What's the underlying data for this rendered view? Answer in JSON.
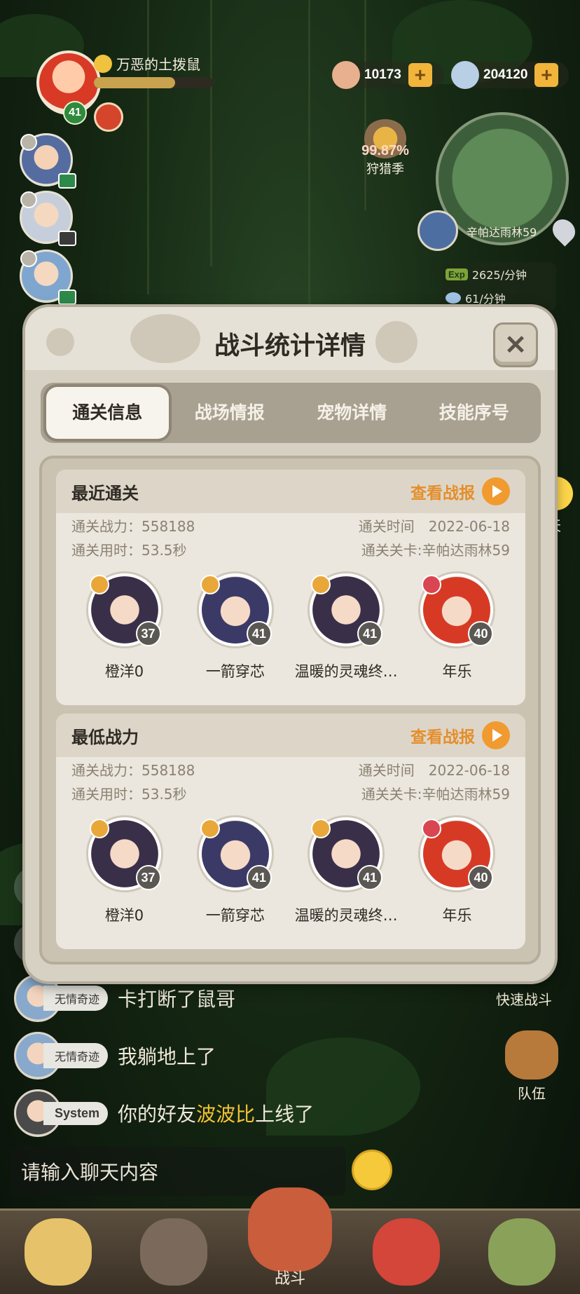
{
  "player": {
    "name": "万恶的土拨鼠",
    "level": "41",
    "xp_fraction": 0.68
  },
  "currency": [
    {
      "icon": "gem-pouch-icon",
      "value": "10173"
    },
    {
      "icon": "stone-icon",
      "value": "204120"
    }
  ],
  "hunt": {
    "percent": "99.87%",
    "label": "狩猎季"
  },
  "map": {
    "location": "辛帕达雨林59"
  },
  "rates": {
    "exp_tag": "Exp",
    "exp_rate": "2625/分钟",
    "stone_rate": "61/分钟"
  },
  "side": {
    "chat_label": "聊天",
    "quick_fight": "快速战斗",
    "team": "队伍"
  },
  "dialog": {
    "title": "战斗统计详情",
    "close": "✕",
    "tabs": [
      "通关信息",
      "战场情报",
      "宠物详情",
      "技能序号"
    ],
    "sections": [
      {
        "title": "最近通关",
        "report_label": "查看战报",
        "power_label": "通关战力：558188",
        "time_label": "通关时间　2022-06-18",
        "duration_label": "通关用时：53.5秒",
        "stage_label": "通关关卡:辛帕达雨林59",
        "heroes": [
          {
            "name": "橙洋0",
            "level": "37"
          },
          {
            "name": "一箭穿芯",
            "level": "41"
          },
          {
            "name": "温暖的灵魂终…",
            "level": "41"
          },
          {
            "name": "年乐",
            "level": "40"
          }
        ]
      },
      {
        "title": "最低战力",
        "report_label": "查看战报",
        "power_label": "通关战力：558188",
        "time_label": "通关时间　2022-06-18",
        "duration_label": "通关用时：53.5秒",
        "stage_label": "通关关卡:辛帕达雨林59",
        "heroes": [
          {
            "name": "橙洋0",
            "level": "37"
          },
          {
            "name": "一箭穿芯",
            "level": "41"
          },
          {
            "name": "温暖的灵魂终…",
            "level": "41"
          },
          {
            "name": "年乐",
            "level": "40"
          }
        ]
      }
    ]
  },
  "chat": {
    "messages": [
      {
        "user": "无情奇迹",
        "text": "卡打断了鼠哥"
      },
      {
        "user": "无情奇迹",
        "text": "我躺地上了"
      },
      {
        "user": "System",
        "text_before": "你的好友",
        "highlight": "波波比",
        "text_after": "上线了"
      }
    ],
    "input_placeholder": "请输入聊天内容"
  },
  "nav": {
    "center_label": "战斗"
  }
}
